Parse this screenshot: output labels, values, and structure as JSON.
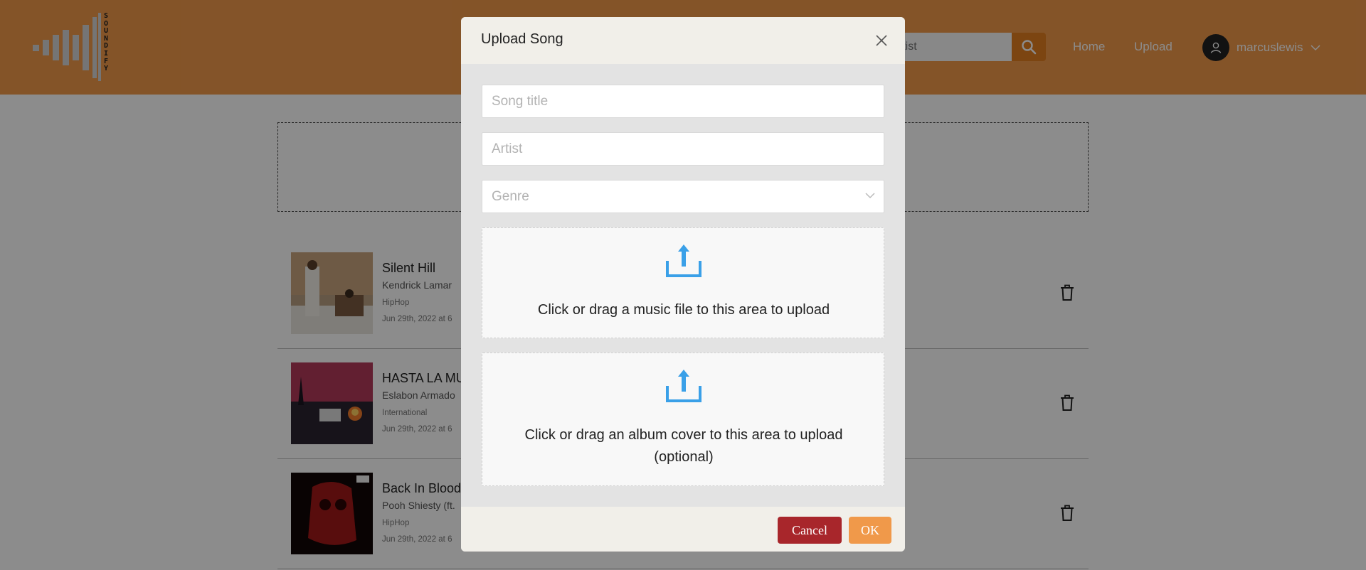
{
  "app": {
    "brand_text": "SOUNDIFY"
  },
  "header": {
    "search": {
      "value": "",
      "placeholder": "Search by song or artist",
      "visible_text": "artist"
    },
    "nav": {
      "home": "Home",
      "upload": "Upload"
    },
    "user": {
      "name": "marcuslewis"
    }
  },
  "songs": [
    {
      "title": "Silent Hill",
      "artist": "Kendrick Lamar",
      "genre": "HipHop",
      "date": "Jun 29th, 2022 at 6"
    },
    {
      "title": "HASTA LA MU",
      "artist": "Eslabon Armado",
      "genre": "International",
      "date": "Jun 29th, 2022 at 6"
    },
    {
      "title": "Back In Blood",
      "artist": "Pooh Shiesty (ft.",
      "genre": "HipHop",
      "date": "Jun 29th, 2022 at 6"
    }
  ],
  "modal": {
    "title": "Upload Song",
    "song_title_placeholder": "Song title",
    "artist_placeholder": "Artist",
    "genre_placeholder": "Genre",
    "music_upload_text": "Click or drag a music file to this area to upload",
    "cover_upload_text_line1": "Click or drag an album cover to this area to upload",
    "cover_upload_text_line2": "(optional)",
    "cancel_label": "Cancel",
    "ok_label": "OK"
  },
  "colors": {
    "header": "#f0994a",
    "search_button": "#e27e1f",
    "cancel": "#a8262b",
    "ok": "#f0994a",
    "upload_icon": "#3aa0e8"
  },
  "icons": {
    "search": "search-icon",
    "close": "close-icon",
    "chevron": "chevron-down-icon",
    "upload": "upload-icon",
    "trash": "trash-icon",
    "user": "user-icon"
  }
}
